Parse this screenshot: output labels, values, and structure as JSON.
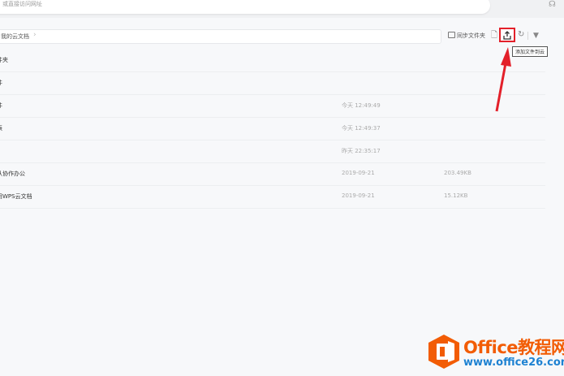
{
  "address_bar": {
    "text": "或直接访问网址"
  },
  "breadcrumb": {
    "label": "我的云文档"
  },
  "toolbar": {
    "sync_label": "同步文件夹",
    "upload_tooltip": "添加文件到云"
  },
  "files": [
    {
      "name": "件夹",
      "time": "",
      "size": ""
    },
    {
      "name": "件",
      "time": "",
      "size": ""
    },
    {
      "name": "件",
      "time": "今天 12:49:49",
      "size": ""
    },
    {
      "name": "表",
      "time": "今天 12:49:37",
      "size": ""
    },
    {
      "name": "",
      "time": "昨天 22:35:17",
      "size": ""
    },
    {
      "name": "队协作办公",
      "time": "2019-09-21",
      "size": "203.49KB"
    },
    {
      "name": "用WPS云文档",
      "time": "2019-09-21",
      "size": "15.12KB"
    }
  ],
  "watermark": {
    "brand": "Office教程网",
    "url": "www.office26.com"
  },
  "colors": {
    "highlight": "#e3202a",
    "brand_orange": "#f25c05",
    "brand_blue": "#1e82d2"
  }
}
